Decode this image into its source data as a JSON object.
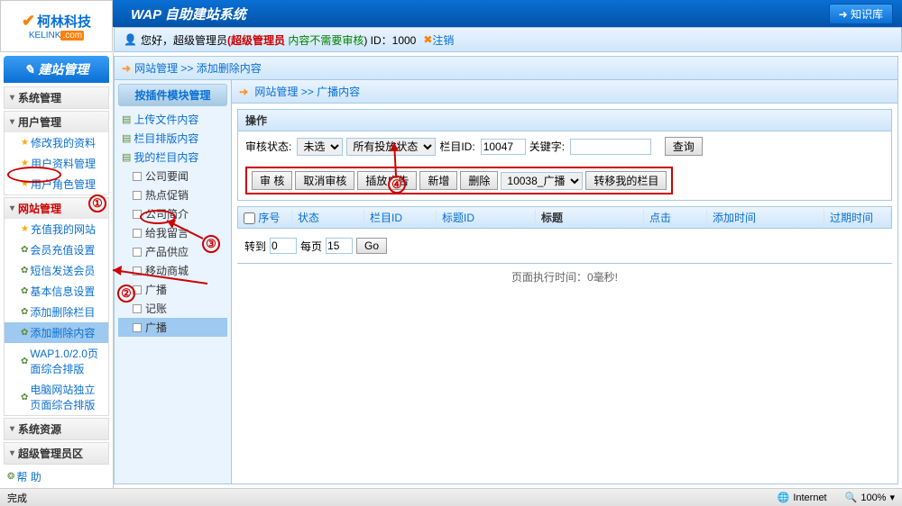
{
  "logo": {
    "brand": "柯林科技",
    "domain_pre": "KELINK",
    "domain_suf": ".com"
  },
  "header": {
    "title": "WAP 自助建站系统",
    "kb_btn": "知识库"
  },
  "userbar": {
    "greeting": "您好，超级管理员",
    "role": "(超级管理员",
    "audit": "内容不需要审核",
    "close_paren": ") ID：1000",
    "logout": "注销"
  },
  "sidebar": {
    "header": "建站管理",
    "groups": [
      {
        "title": "系统管理",
        "items": []
      },
      {
        "title": "用户管理",
        "items": [
          {
            "label": "修改我的资料",
            "icon": "star"
          },
          {
            "label": "用户资料管理",
            "icon": "star"
          },
          {
            "label": "用户角色管理",
            "icon": "star"
          }
        ]
      },
      {
        "title": "网站管理",
        "active": true,
        "items": [
          {
            "label": "充值我的网站",
            "icon": "star"
          },
          {
            "label": "会员充值设置",
            "icon": "gear"
          },
          {
            "label": "短信发送会员",
            "icon": "gear"
          },
          {
            "label": "基本信息设置",
            "icon": "gear"
          },
          {
            "label": "添加删除栏目",
            "icon": "gear"
          },
          {
            "label": "添加删除内容",
            "icon": "gear",
            "selected": true
          },
          {
            "label": "WAP1.0/2.0页面综合排版",
            "icon": "gear"
          },
          {
            "label": "电脑网站独立页面综合排版",
            "icon": "gear"
          }
        ]
      },
      {
        "title": "系统资源",
        "items": []
      },
      {
        "title": "超级管理员区",
        "items": []
      }
    ],
    "help": "帮 助"
  },
  "breadcrumb": {
    "path": "网站管理 >> 添加删除内容"
  },
  "tree": {
    "title": "按插件模块管理",
    "roots": [
      {
        "label": "上传文件内容"
      },
      {
        "label": "栏目排版内容"
      },
      {
        "label": "我的栏目内容",
        "children": [
          "公司要闻",
          "热点促销",
          "公司简介",
          "给我留言",
          "产品供应",
          "移动商城",
          "广播",
          "记账",
          "广播"
        ]
      }
    ]
  },
  "detail_bc": "网站管理 >> 广播内容",
  "ops": {
    "title": "操作",
    "status_label": "审核状态:",
    "status_sel": "未选",
    "placement_sel": "所有投放状态",
    "col_id_label": "栏目ID:",
    "col_id_val": "10047",
    "keyword_label": "关键字:",
    "query_btn": "查询",
    "btns": [
      "审 核",
      "取消审核",
      "插放广告",
      "新增",
      "删除"
    ],
    "move_sel": "10038_广播",
    "move_btn": "转移我的栏目"
  },
  "table": {
    "headers": [
      "序号",
      "状态",
      "栏目ID",
      "标题ID",
      "标题",
      "点击",
      "添加时间",
      "过期时间"
    ]
  },
  "pager": {
    "goto_label": "转到",
    "goto_val": "0",
    "perpage_label": "每页",
    "perpage_val": "15",
    "go_btn": "Go"
  },
  "exec_time": "页面执行时间：0毫秒!",
  "annotations": {
    "a1": "①",
    "a2": "②",
    "a3": "③",
    "a4": "④"
  },
  "status": {
    "done": "完成",
    "zone": "Internet",
    "zoom": "100%"
  }
}
